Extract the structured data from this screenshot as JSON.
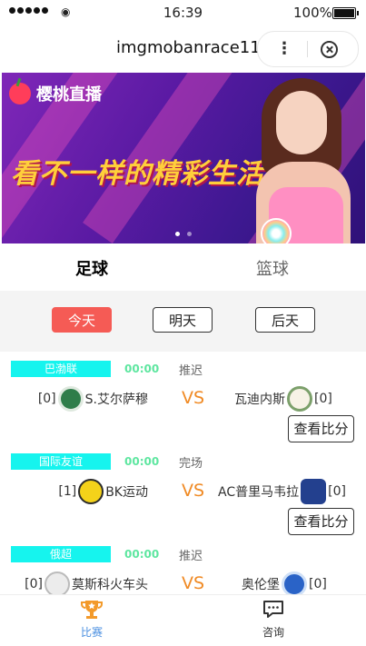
{
  "status_bar": {
    "time": "16:39",
    "battery": "100%"
  },
  "title_bar": {
    "title": "imgmobanrace11"
  },
  "banner": {
    "logo_text": "樱桃直播",
    "slogan": "看不一样的精彩生活"
  },
  "tabs": [
    {
      "label": "足球"
    },
    {
      "label": "篮球"
    }
  ],
  "days": [
    {
      "label": "今天"
    },
    {
      "label": "明天"
    },
    {
      "label": "后天"
    }
  ],
  "matches": [
    {
      "league": "巴渤联",
      "time": "00:00",
      "status": "推迟",
      "home": {
        "score": "[0]",
        "name": "S.艾尔萨穆"
      },
      "vs": "VS",
      "away": {
        "name": "瓦迪内斯",
        "score": "[0]"
      },
      "action": "查看比分"
    },
    {
      "league": "国际友谊",
      "time": "00:00",
      "status": "完场",
      "home": {
        "score": "[1]",
        "name": "BK运动"
      },
      "vs": "VS",
      "away": {
        "name": "AC普里马韦拉",
        "score": "[0]"
      },
      "action": "查看比分"
    },
    {
      "league": "俄超",
      "time": "00:00",
      "status": "推迟",
      "home": {
        "score": "[0]",
        "name": "莫斯科火车头"
      },
      "vs": "VS",
      "away": {
        "name": "奥伦堡",
        "score": "[0]"
      }
    }
  ],
  "bottom_nav": [
    {
      "label": "比赛"
    },
    {
      "label": "咨询"
    }
  ],
  "colors": {
    "accent_red": "#f55b55",
    "league_tag": "#16f4ee",
    "vs": "#f08a24",
    "time": "#5ee6a0",
    "nav_active": "#4a8fe0"
  }
}
